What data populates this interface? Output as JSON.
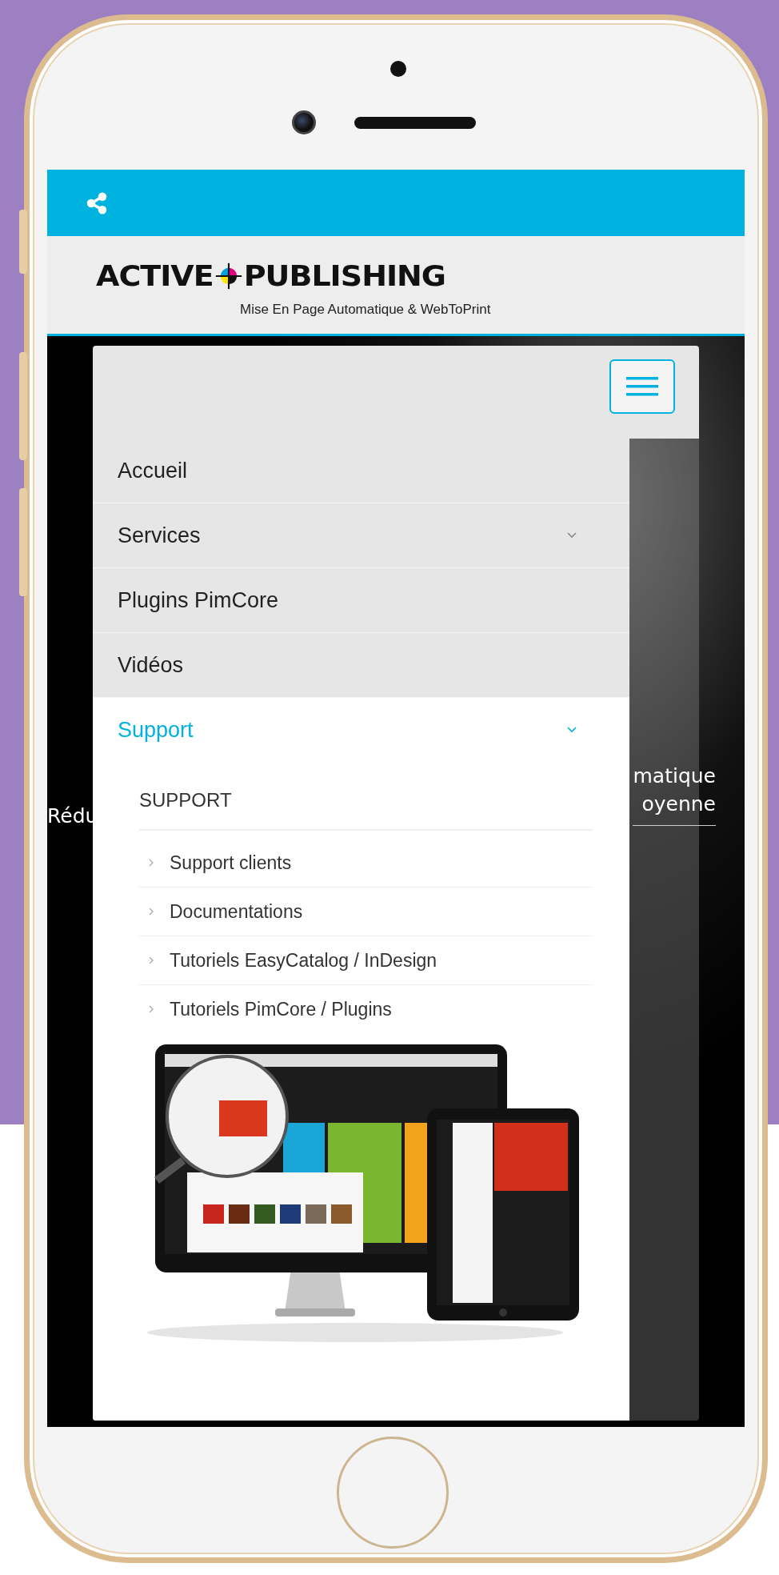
{
  "logo": {
    "name_left": "ACTIVE",
    "name_right": "PUBLISHING",
    "tagline": "Mise En Page Automatique & WebToPrint"
  },
  "hero": {
    "left_fragment": "Rédu",
    "right_fragments": [
      "matique",
      "oyenne"
    ]
  },
  "menu": {
    "items": [
      {
        "label": "Accueil",
        "has_submenu": false,
        "selected": false,
        "expanded": false
      },
      {
        "label": "Services",
        "has_submenu": true,
        "selected": false,
        "expanded": false
      },
      {
        "label": "Plugins PimCore",
        "has_submenu": false,
        "selected": false,
        "expanded": false
      },
      {
        "label": "Vidéos",
        "has_submenu": false,
        "selected": false,
        "expanded": false
      },
      {
        "label": "Support",
        "has_submenu": true,
        "selected": true,
        "expanded": true,
        "submenu": {
          "heading": "SUPPORT",
          "links": [
            "Support clients",
            "Documentations",
            "Tutoriels EasyCatalog / InDesign",
            "Tutoriels PimCore / Plugins"
          ]
        }
      }
    ]
  }
}
